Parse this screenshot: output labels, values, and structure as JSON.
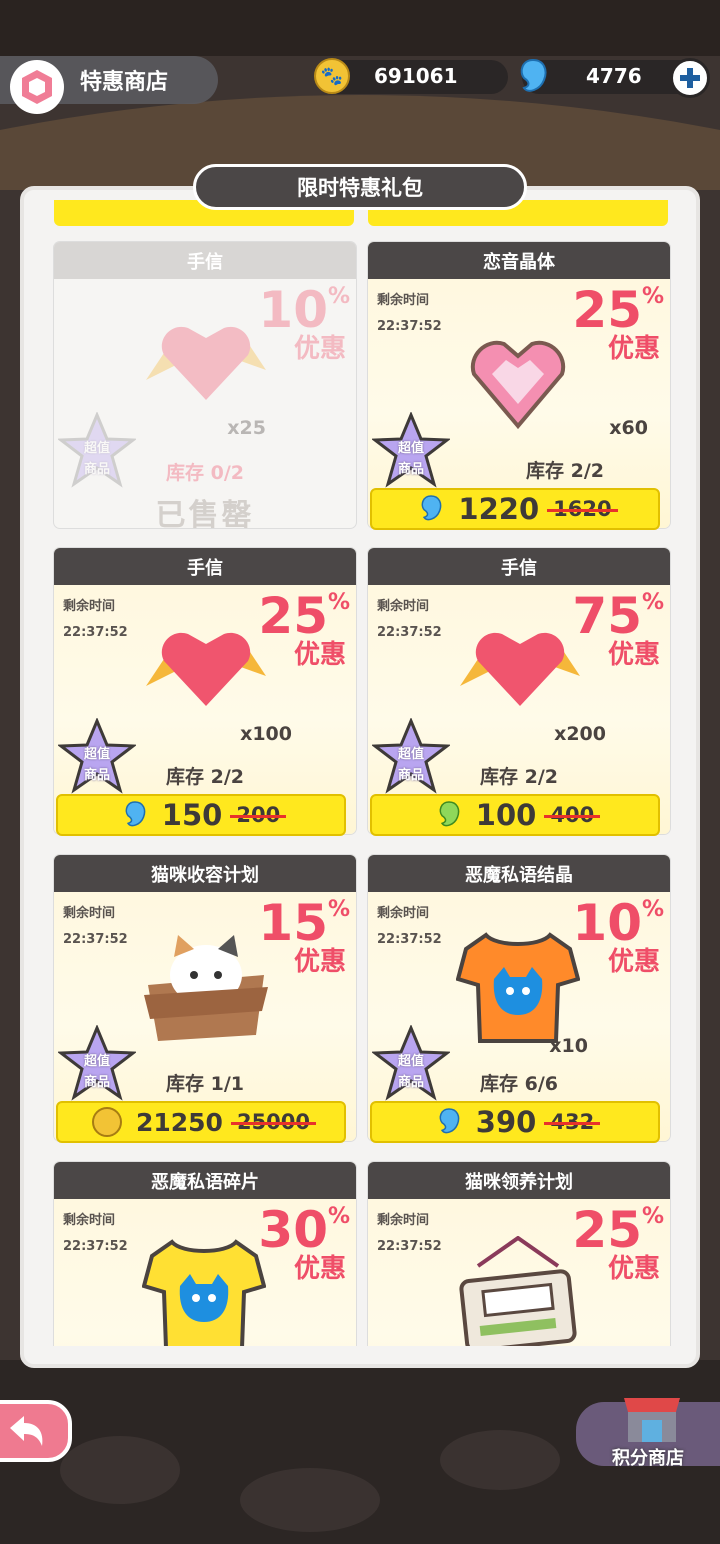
{
  "header": {
    "title": "特惠商店",
    "coins": "691061",
    "gems": "4776",
    "shop_icon": "shop-badge-icon",
    "add_icon": "plus-icon"
  },
  "panel": {
    "title": "限时特惠礼包"
  },
  "labels": {
    "timer_label": "剩余时间",
    "discount_suffix": "优惠",
    "super_value_1": "超值",
    "super_value_2": "商品"
  },
  "cards": [
    {
      "title": "手信",
      "discount": "10",
      "pct": "%",
      "qty": "x25",
      "stock": "库存 0/2",
      "status": "已售罄",
      "item_icon": "winged-heart-icon"
    },
    {
      "title": "恋音晶体",
      "timer": "22:37:52",
      "discount": "25",
      "pct": "%",
      "qty": "x60",
      "stock": "库存 2/2",
      "price": "1220",
      "old_price": "1620",
      "currency": "gem",
      "item_icon": "heart-crystal-icon"
    },
    {
      "title": "手信",
      "timer": "22:37:52",
      "discount": "25",
      "pct": "%",
      "qty": "x100",
      "stock": "库存 2/2",
      "price": "150",
      "old_price": "200",
      "currency": "gem",
      "item_icon": "winged-heart-icon"
    },
    {
      "title": "手信",
      "timer": "22:37:52",
      "discount": "75",
      "pct": "%",
      "qty": "x200",
      "stock": "库存 2/2",
      "price": "100",
      "old_price": "400",
      "currency": "green-gem",
      "item_icon": "winged-heart-icon"
    },
    {
      "title": "猫咪收容计划",
      "timer": "22:37:52",
      "discount": "15",
      "pct": "%",
      "qty": "",
      "stock": "库存 1/1",
      "price": "21250",
      "old_price": "25000",
      "currency": "coin",
      "item_icon": "cat-in-box-icon"
    },
    {
      "title": "恶魔私语结晶",
      "timer": "22:37:52",
      "discount": "10",
      "pct": "%",
      "qty": "x10",
      "stock": "库存 6/6",
      "price": "390",
      "old_price": "432",
      "currency": "gem",
      "item_icon": "orange-cat-shirt-icon"
    },
    {
      "title": "恶魔私语碎片",
      "timer": "22:37:52",
      "discount": "30",
      "pct": "%",
      "qty": "",
      "stock": "",
      "item_icon": "yellow-cat-shirt-icon"
    },
    {
      "title": "猫咪领养计划",
      "timer": "22:37:52",
      "discount": "25",
      "pct": "%",
      "qty": "",
      "stock": "",
      "item_icon": "adoption-card-icon"
    }
  ],
  "footer": {
    "back_icon": "back-arrow-icon",
    "points_shop_label": "积分商店",
    "points_shop_icon": "storefront-icon"
  },
  "colors": {
    "discount_red": "#ef4e68",
    "price_yellow": "#ffe81e",
    "header_dark": "#4b4747",
    "strike_red": "#e8322b"
  }
}
